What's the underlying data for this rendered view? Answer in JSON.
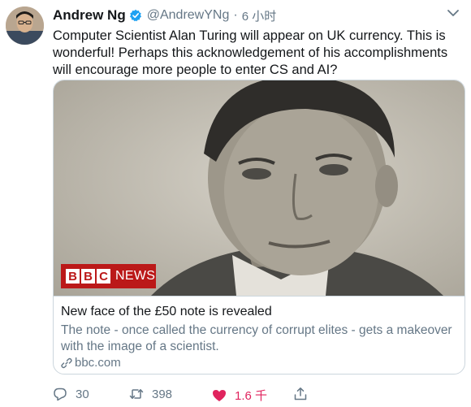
{
  "author": {
    "name": "Andrew Ng",
    "handle": "@AndrewYNg",
    "separator": "·",
    "time": "6 小时"
  },
  "tweet": {
    "text": "Computer Scientist Alan Turing will appear on UK currency. This is wonderful! Perhaps this acknowledgement of his accomplishments will encourage more people to enter CS and AI?"
  },
  "card": {
    "logo_box_1": "B",
    "logo_box_2": "B",
    "logo_box_3": "C",
    "logo_news": "NEWS",
    "title": "New face of the £50 note is revealed",
    "description": "The note - once called the currency of corrupt elites - gets a makeover with the image of a scientist.",
    "link": "bbc.com"
  },
  "actions": {
    "reply_count": "30",
    "retweet_count": "398",
    "like_count": "1.6 千"
  },
  "icons": {
    "verified": "verified-badge-icon",
    "caret": "chevron-down-icon",
    "link": "link-icon",
    "reply": "reply-icon",
    "retweet": "retweet-icon",
    "like": "heart-icon",
    "share": "share-icon"
  },
  "colors": {
    "verified_blue": "#1da1f2",
    "like_red": "#e0245e",
    "bbc_red": "#bb1919",
    "secondary_text": "#657786"
  }
}
